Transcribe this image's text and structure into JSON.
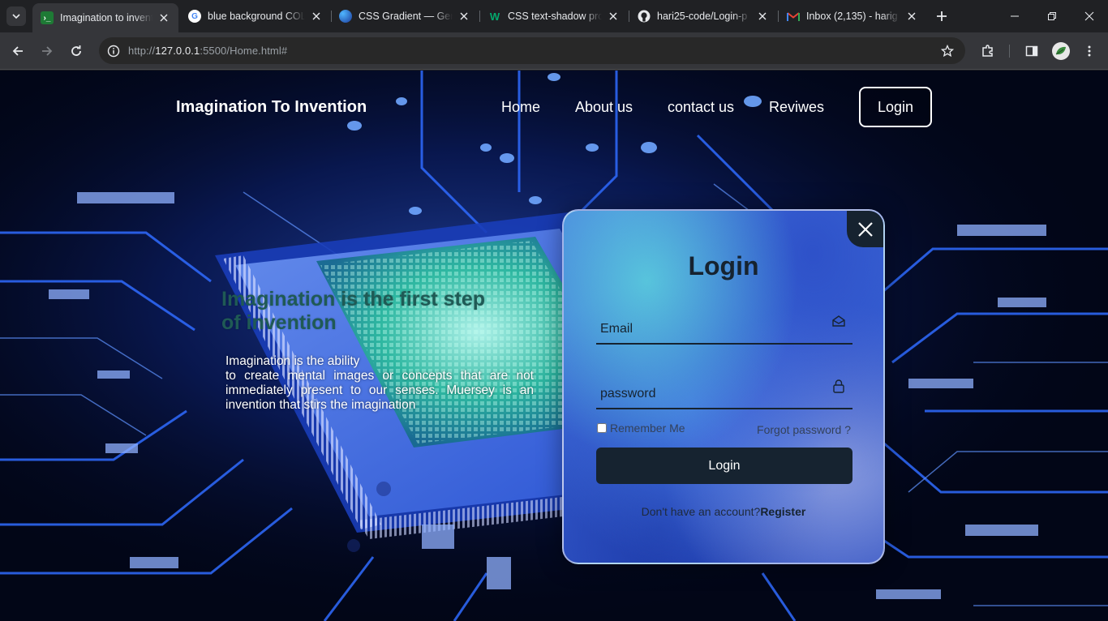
{
  "browser": {
    "tabs": [
      {
        "title": "Imagination to invent",
        "favicon": "vscode-live-icon",
        "active": true
      },
      {
        "title": "blue background COL",
        "favicon": "google-icon",
        "active": false
      },
      {
        "title": "CSS Gradient — Gene",
        "favicon": "cssgradient-icon",
        "active": false
      },
      {
        "title": "CSS text-shadow prop",
        "favicon": "w3schools-icon",
        "active": false
      },
      {
        "title": "hari25-code/Login-p",
        "favicon": "github-icon",
        "active": false
      },
      {
        "title": "Inbox (2,135) - harig",
        "favicon": "gmail-icon",
        "active": false
      }
    ],
    "url_prefix": "http://",
    "url_host": "127.0.0.1",
    "url_rest": ":5500/Home.html#"
  },
  "nav": {
    "logo": "Imagination To Invention",
    "links": [
      "Home",
      "About us",
      "contact us",
      "Reviwes"
    ],
    "login": "Login"
  },
  "hero": {
    "title": "Imagination is the first step of invention",
    "text_line1": "Imagination is the ability",
    "text_body": "to create mental images or concepts that are not immediately present to our senses. Muersey is an invention that stirs the imagination"
  },
  "login_form": {
    "title": "Login",
    "email_placeholder": "Email",
    "password_placeholder": "password",
    "remember": "Remember Me",
    "forgot": "Forgot password ?",
    "submit": "Login",
    "no_account": "Don't have an account?",
    "register": "Register"
  },
  "colors": {
    "modal_dark": "#162330",
    "hero_title": "#1f5a55",
    "circuit_glow": "#3a6cff"
  }
}
